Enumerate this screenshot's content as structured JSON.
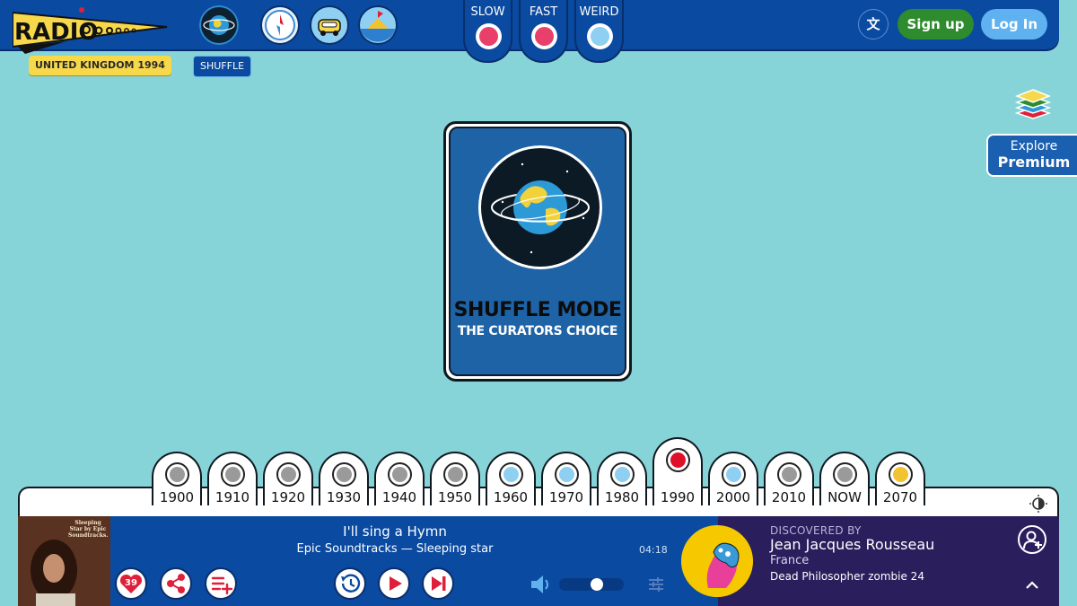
{
  "app": {
    "logo_text": "RADIOoooo",
    "country_year": "UNITED KINGDOM 1994",
    "mode_badge": "SHUFFLE"
  },
  "speeds": [
    {
      "label": "SLOW",
      "color": "#e8406a"
    },
    {
      "label": "FAST",
      "color": "#e8406a"
    },
    {
      "label": "WEIRD",
      "color": "#8fd0f2"
    }
  ],
  "header": {
    "lang_icon": "translate-icon",
    "signup_label": "Sign up",
    "login_label": "Log In"
  },
  "premium": {
    "line1": "Explore",
    "line2": "Premium"
  },
  "card": {
    "title": "SHUFFLE MODE",
    "subtitle": "THE CURATORS CHOICE"
  },
  "decades": [
    {
      "label": "1900",
      "color": "#9a9a9a",
      "active": false
    },
    {
      "label": "1910",
      "color": "#9a9a9a",
      "active": false
    },
    {
      "label": "1920",
      "color": "#9a9a9a",
      "active": false
    },
    {
      "label": "1930",
      "color": "#9a9a9a",
      "active": false
    },
    {
      "label": "1940",
      "color": "#9a9a9a",
      "active": false
    },
    {
      "label": "1950",
      "color": "#9a9a9a",
      "active": false
    },
    {
      "label": "1960",
      "color": "#8fd0f2",
      "active": false
    },
    {
      "label": "1970",
      "color": "#8fd0f2",
      "active": false
    },
    {
      "label": "1980",
      "color": "#8fd0f2",
      "active": false
    },
    {
      "label": "1990",
      "color": "#e0102a",
      "active": true
    },
    {
      "label": "2000",
      "color": "#8fd0f2",
      "active": false
    },
    {
      "label": "2010",
      "color": "#9a9a9a",
      "active": false
    },
    {
      "label": "NOW",
      "color": "#9a9a9a",
      "active": false
    },
    {
      "label": "2070",
      "color": "#f2c230",
      "active": false
    }
  ],
  "player": {
    "title": "I'll sing a Hymn",
    "artist_album": "Epic Soundtracks — Sleeping star",
    "time": "04:18",
    "like_count": "39",
    "album_text": "Sleeping Star by Epic Soundtracks.",
    "volume": 0.6
  },
  "curator": {
    "label": "DISCOVERED BY",
    "name": "Jean Jacques Rousseau",
    "country": "France",
    "show": "Dead Philosopher zombie 24"
  }
}
